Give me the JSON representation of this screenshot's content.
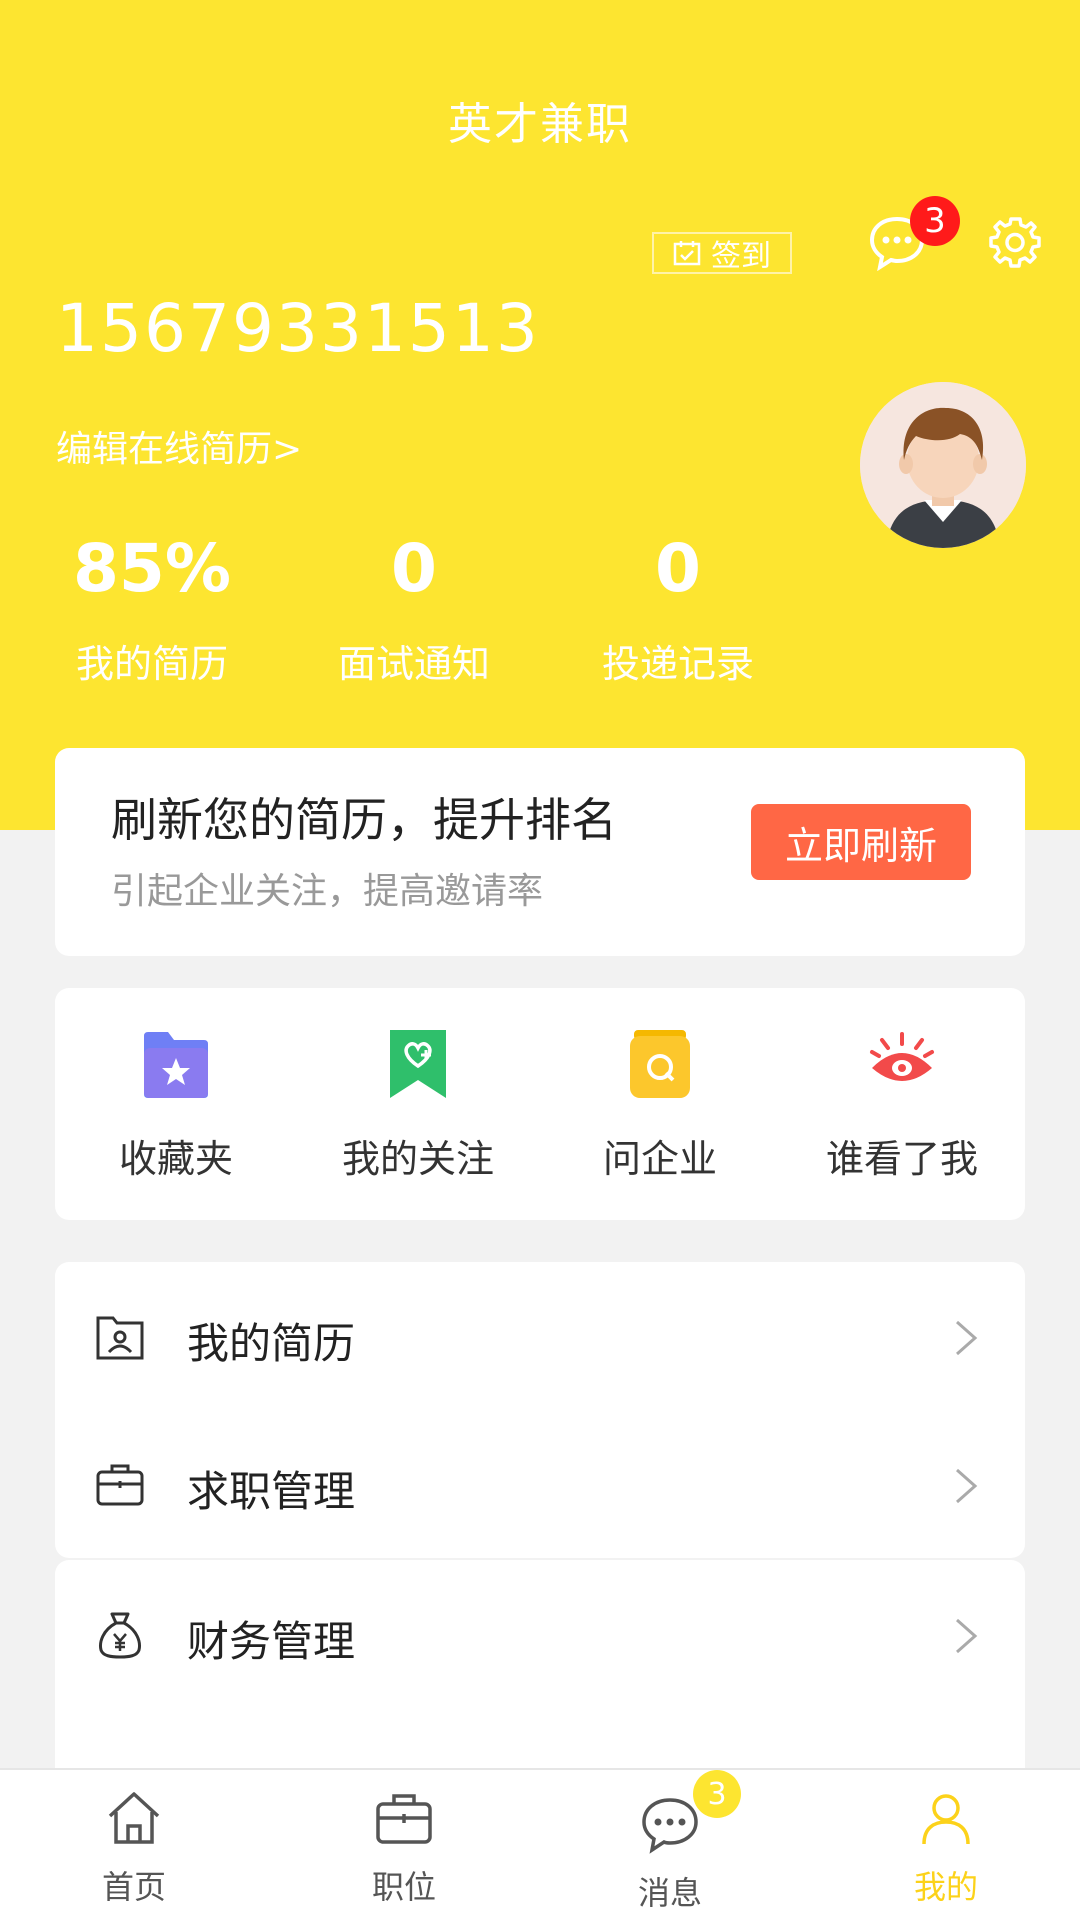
{
  "header": {
    "title": "英才兼职",
    "signin_label": "签到",
    "message_count": "3",
    "phone": "15679331513",
    "edit_resume_link": "编辑在线简历>",
    "background_color": "#fde530"
  },
  "stats": [
    {
      "value": "85%",
      "label": "我的简历"
    },
    {
      "value": "0",
      "label": "面试通知"
    },
    {
      "value": "0",
      "label": "投递记录"
    }
  ],
  "refresh_card": {
    "title": "刷新您的简历，提升排名",
    "subtitle": "引起企业关注，提高邀请率",
    "button_label": "立即刷新",
    "button_color": "#ff6745"
  },
  "quick_actions": [
    {
      "label": "收藏夹",
      "icon": "favorites-folder-icon"
    },
    {
      "label": "我的关注",
      "icon": "heart-bookmark-icon"
    },
    {
      "label": "问企业",
      "icon": "ask-company-icon"
    },
    {
      "label": "谁看了我",
      "icon": "eye-icon"
    }
  ],
  "menu": [
    {
      "label": "我的简历",
      "icon": "resume-folder-icon"
    },
    {
      "label": "求职管理",
      "icon": "briefcase-icon"
    },
    {
      "label": "财务管理",
      "icon": "money-bag-icon"
    }
  ],
  "tabbar": {
    "items": [
      {
        "label": "首页",
        "icon": "home-icon"
      },
      {
        "label": "职位",
        "icon": "briefcase-icon"
      },
      {
        "label": "消息",
        "icon": "chat-icon"
      },
      {
        "label": "我的",
        "icon": "person-icon"
      }
    ],
    "message_badge": "3",
    "active_color": "#fcd21a"
  }
}
